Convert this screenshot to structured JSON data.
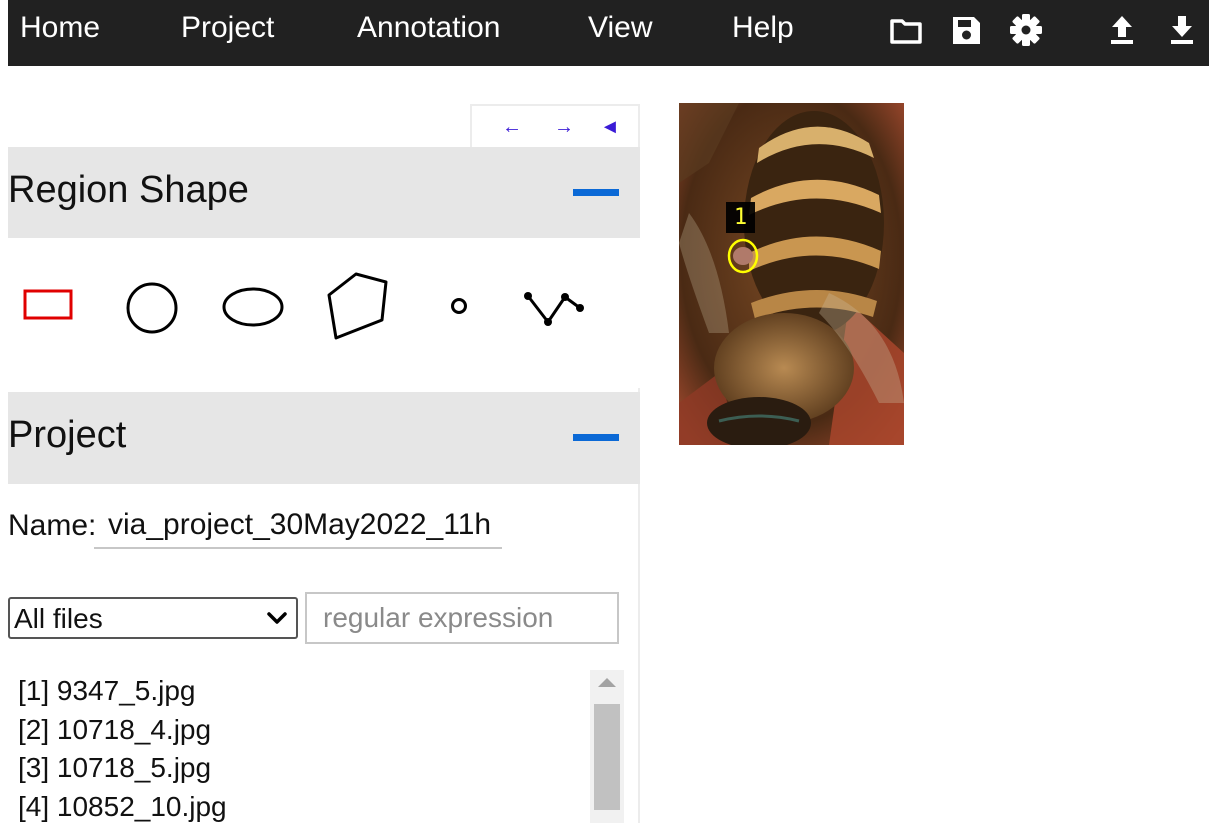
{
  "menu": {
    "items": [
      "Home",
      "Project",
      "Annotation",
      "View",
      "Help"
    ],
    "tools": [
      "folder-open-icon",
      "save-icon",
      "gear-icon",
      "upload-icon",
      "download-icon"
    ]
  },
  "left_panel": {
    "nav_arrows": [
      "←",
      "→",
      "◄"
    ],
    "region_shape": {
      "title": "Region Shape",
      "shapes": [
        "rectangle",
        "circle",
        "ellipse",
        "polygon",
        "point",
        "polyline"
      ],
      "selected": "rectangle"
    },
    "project": {
      "title": "Project",
      "name_label": "Name:",
      "name_value": "via_project_30May2022_11h",
      "filter_selected": "All files",
      "filter_placeholder": "regular expression",
      "files": [
        "[1] 9347_5.jpg",
        "[2] 10718_4.jpg",
        "[3] 10718_5.jpg",
        "[4] 10852_10.jpg"
      ]
    }
  },
  "canvas": {
    "region_label": "1"
  },
  "colors": {
    "menubar": "#212121",
    "accent_blue": "#0b69d6",
    "selected_shape": "#e00000",
    "region_stroke": "#ffff00",
    "section_header": "#e6e6e6"
  }
}
